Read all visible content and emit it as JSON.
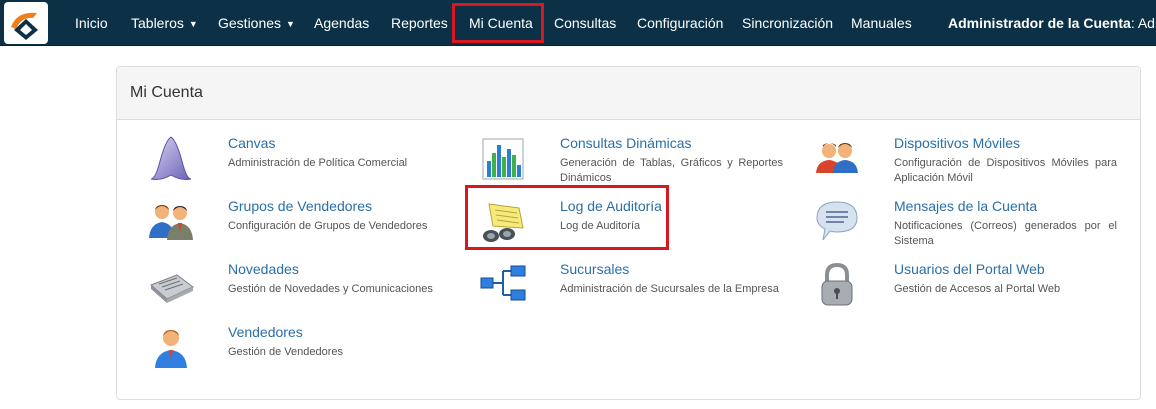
{
  "navbar": {
    "items": [
      {
        "label": "Inicio"
      },
      {
        "label": "Tableros",
        "caret": "▼"
      },
      {
        "label": "Gestiones",
        "caret": "▼"
      },
      {
        "label": "Agendas"
      },
      {
        "label": "Reportes"
      },
      {
        "label": "Mi Cuenta"
      },
      {
        "label": "Consultas"
      },
      {
        "label": "Configuración"
      },
      {
        "label": "Sincronización"
      },
      {
        "label": "Manuales"
      }
    ],
    "user_prefix": "Administrador de la Cuenta",
    "user_name": ": Admin"
  },
  "panel": {
    "title": "Mi Cuenta",
    "items": [
      {
        "title": "Canvas",
        "desc": "Administración de Política Comercial",
        "icon": "canvas-icon"
      },
      {
        "title": "Consultas Dinámicas",
        "desc": "Generación de Tablas, Gráficos y Reportes Dinámicos",
        "icon": "chart-icon"
      },
      {
        "title": "Dispositivos Móviles",
        "desc": "Configuración de Dispositivos Móviles para Aplicación Móvil",
        "icon": "users-group-icon"
      },
      {
        "title": "Grupos de Vendedores",
        "desc": "Configuración de Grupos de Vendedores",
        "icon": "business-users-icon"
      },
      {
        "title": "Log de Auditoría",
        "desc": "Log de Auditoría",
        "icon": "binoculars-icon"
      },
      {
        "title": "Mensajes de la Cuenta",
        "desc": "Notificaciones (Correos) generados por el Sistema",
        "icon": "speech-bubble-icon"
      },
      {
        "title": "Novedades",
        "desc": "Gestión de Novedades y Comunicaciones",
        "icon": "newspaper-icon"
      },
      {
        "title": "Sucursales",
        "desc": "Administración de Sucursales de la Empresa",
        "icon": "hierarchy-icon"
      },
      {
        "title": "Usuarios del Portal Web",
        "desc": "Gestión de Accesos al Portal Web",
        "icon": "padlock-icon"
      },
      {
        "title": "Vendedores",
        "desc": "Gestión de Vendedores",
        "icon": "user-icon"
      }
    ]
  },
  "colors": {
    "navbar_bg": "#0c3146",
    "highlight": "#d7191f",
    "link": "#2a6fa8"
  }
}
